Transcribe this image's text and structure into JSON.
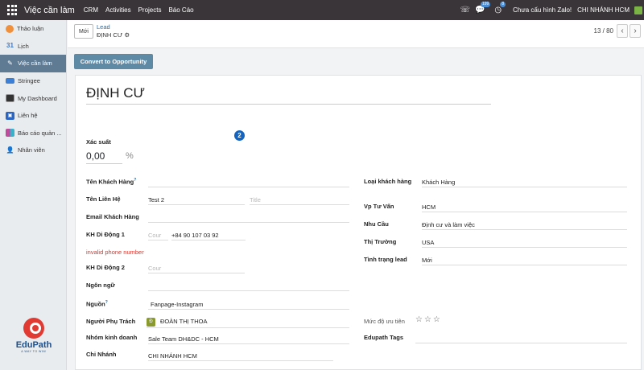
{
  "topbar": {
    "app_title": "Việc cần làm",
    "menu": [
      "CRM",
      "Activities",
      "Projects",
      "Báo Cáo"
    ],
    "messages_count": "199",
    "activities_count": "8",
    "company_warning": "Chưa cấu hình Zalo!",
    "branch": "CHI NHÁNH HCM"
  },
  "sidebar": {
    "items": [
      {
        "label": "Thảo luận",
        "icon": "discuss-icon",
        "color": "#f0903c"
      },
      {
        "label": "Lịch",
        "icon": "calendar-icon",
        "color": "#3c78c8"
      },
      {
        "label": "Việc cần làm",
        "icon": "todo-icon",
        "color": "#ffffff"
      },
      {
        "label": "Stringee",
        "icon": "stringee-icon",
        "color": "#3b7fd6"
      },
      {
        "label": "My Dashboard",
        "icon": "dashboard-icon",
        "color": "#333"
      },
      {
        "label": "Liên hệ",
        "icon": "contacts-icon",
        "color": "#2b66c3"
      },
      {
        "label": "Báo cáo quản ...",
        "icon": "report-icon",
        "color": "#c04a9b"
      },
      {
        "label": "Nhân viên",
        "icon": "employees-icon",
        "color": "#e6a23c"
      }
    ],
    "logo_text": "EduPath",
    "logo_tagline": "A WAY TO WIN!"
  },
  "control": {
    "new_label": "Mới",
    "breadcrumb_parent": "Lead",
    "breadcrumb_current": "ĐỊNH CƯ",
    "pager": "13 / 80"
  },
  "status": {
    "convert_label": "Convert to Opportunity"
  },
  "form": {
    "title": "ĐỊNH CƯ",
    "step_badge": "2",
    "probability_label": "Xác suất",
    "probability_value": "0,00",
    "probability_unit": "%",
    "left": {
      "customer_name_label": "Tên Khách Hàng",
      "customer_name_value": "",
      "contact_name_label": "Tên Liên Hệ",
      "contact_name_value": "Test 2",
      "title_placeholder": "Title",
      "email_label": "Email Khách Hàng",
      "email_value": "",
      "mobile1_label": "KH Di Động 1",
      "mobile1_country_placeholder": "Cour",
      "mobile1_value": "+84 90 107 03 92",
      "mobile1_error": "invalid phone number",
      "mobile2_label": "KH Di Động 2",
      "mobile2_country_placeholder": "Cour",
      "language_label": "Ngôn ngữ",
      "source_label": "Nguồn",
      "source_value": "Fanpage-Instagram",
      "owner_label": "Người Phụ Trách",
      "owner_avatar": "Đ",
      "owner_value": "ĐOÀN THỊ THOA",
      "sales_team_label": "Nhóm kinh doanh",
      "sales_team_value": "Sale Team DH&DC - HCM",
      "branch_label": "Chi Nhánh",
      "branch_value": "CHI NHÁNH HCM"
    },
    "right": {
      "customer_type_label": "Loại khách hàng",
      "customer_type_value": "Khách Hàng",
      "office_label": "Vp Tư Vấn",
      "office_value": "HCM",
      "need_label": "Nhu Cầu",
      "need_value": "Định cư và làm việc",
      "market_label": "Thị Trường",
      "market_value": "USA",
      "lead_status_label": "Tình trạng lead",
      "lead_status_value": "Mới",
      "priority_label": "Mức độ ưu tiên",
      "priority_stars": "☆☆☆",
      "tags_label": "Edupath Tags"
    }
  }
}
